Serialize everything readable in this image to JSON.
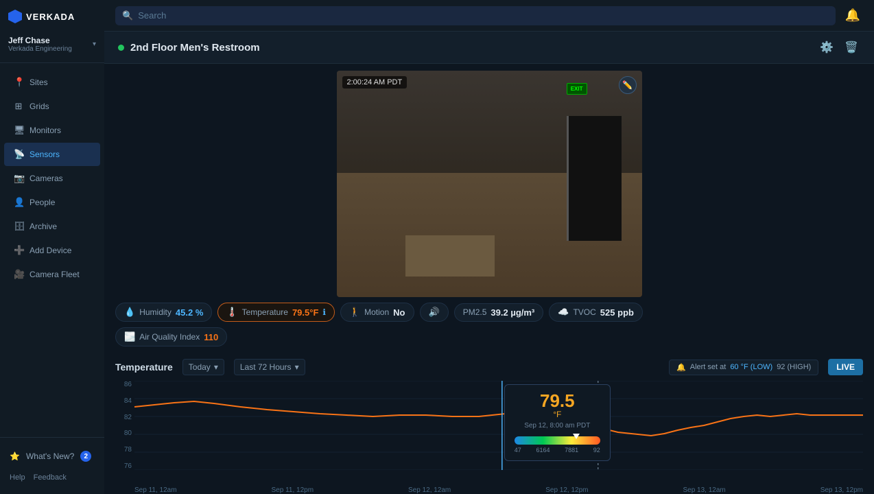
{
  "sidebar": {
    "logo": "VERKADA",
    "user": {
      "name": "Jeff Chase",
      "org": "Verkada Engineering"
    },
    "nav_items": [
      {
        "id": "sites",
        "label": "Sites",
        "icon": "📍",
        "active": false
      },
      {
        "id": "grids",
        "label": "Grids",
        "icon": "⊞",
        "active": false
      },
      {
        "id": "monitors",
        "label": "Monitors",
        "icon": "🖥",
        "active": false
      },
      {
        "id": "sensors",
        "label": "Sensors",
        "icon": "📡",
        "active": true
      },
      {
        "id": "cameras",
        "label": "Cameras",
        "icon": "📷",
        "active": false
      },
      {
        "id": "people",
        "label": "People",
        "icon": "👤",
        "active": false
      },
      {
        "id": "archive",
        "label": "Archive",
        "icon": "🗄",
        "active": false
      },
      {
        "id": "add-device",
        "label": "Add Device",
        "icon": "➕",
        "active": false
      },
      {
        "id": "camera-fleet",
        "label": "Camera Fleet",
        "icon": "🎥",
        "active": false
      }
    ],
    "whats_new_label": "What's New?",
    "whats_new_badge": "2",
    "help_label": "Help",
    "feedback_label": "Feedback"
  },
  "topbar": {
    "search_placeholder": "Search"
  },
  "device": {
    "name": "2nd Floor Men's Restroom",
    "status": "online"
  },
  "camera": {
    "timestamp": "2:00:24 AM PDT",
    "exit_sign": "EXIT"
  },
  "metrics": {
    "humidity_label": "Humidity",
    "humidity_value": "45.2",
    "humidity_unit": "%",
    "temperature_label": "Temperature",
    "temperature_value": "79.5",
    "temperature_unit": "°F",
    "motion_label": "Motion",
    "motion_value": "No",
    "pm25_label": "PM2.5",
    "pm25_value": "39.2",
    "pm25_unit": "µg/m³",
    "tvoc_label": "TVOC",
    "tvoc_value": "525",
    "tvoc_unit": "ppb",
    "aqi_label": "Air Quality Index",
    "aqi_value": "110"
  },
  "chart": {
    "title": "Temperature",
    "filter_today": "Today",
    "filter_range": "Last 72 Hours",
    "alert_label": "Alert set at",
    "alert_low_val": "60",
    "alert_low_unit": "°F (LOW)",
    "alert_high_val": "92",
    "alert_high_unit": "(HIGH)",
    "live_label": "LIVE",
    "y_labels": [
      "86",
      "84",
      "82",
      "80",
      "78",
      "76"
    ],
    "x_labels": [
      "Sep 11, 12am",
      "Sep 11, 12pm",
      "Sep 12, 12am",
      "Sep 12, 12pm",
      "Sep 13, 12am",
      "Sep 13, 12pm"
    ],
    "tooltip": {
      "value": "79.5",
      "unit": "°F",
      "date": "Sep 12, 8:00 am PDT",
      "gauge_labels": [
        "47",
        "6164",
        "7881",
        "92"
      ],
      "marker_pct": "72"
    }
  }
}
